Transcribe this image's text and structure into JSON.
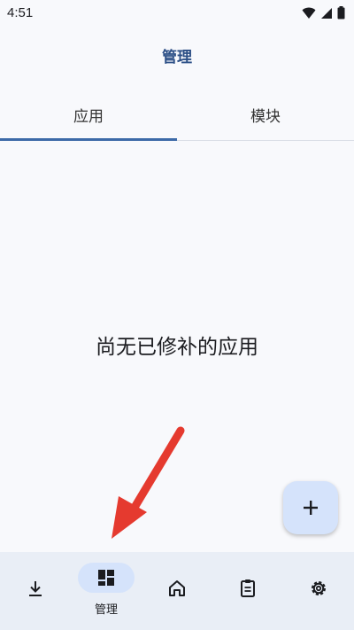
{
  "status_bar": {
    "time": "4:51"
  },
  "app_bar": {
    "title": "管理"
  },
  "tabs": [
    {
      "label": "应用",
      "selected": true
    },
    {
      "label": "模块",
      "selected": false
    }
  ],
  "content": {
    "empty_message": "尚无已修补的应用"
  },
  "fab": {
    "icon": "plus-icon"
  },
  "bottom_nav": {
    "items": [
      {
        "icon": "download-icon",
        "label": ""
      },
      {
        "icon": "dashboard-icon",
        "label": "管理",
        "selected": true
      },
      {
        "icon": "home-icon",
        "label": ""
      },
      {
        "icon": "clipboard-icon",
        "label": ""
      },
      {
        "icon": "gear-icon",
        "label": ""
      }
    ]
  },
  "colors": {
    "accent": "#3d6aa8",
    "title": "#2c4f86",
    "nav_bg": "#e9eef6",
    "selected_pill": "#d5e3fb",
    "annotation_arrow": "#e53a2f"
  }
}
